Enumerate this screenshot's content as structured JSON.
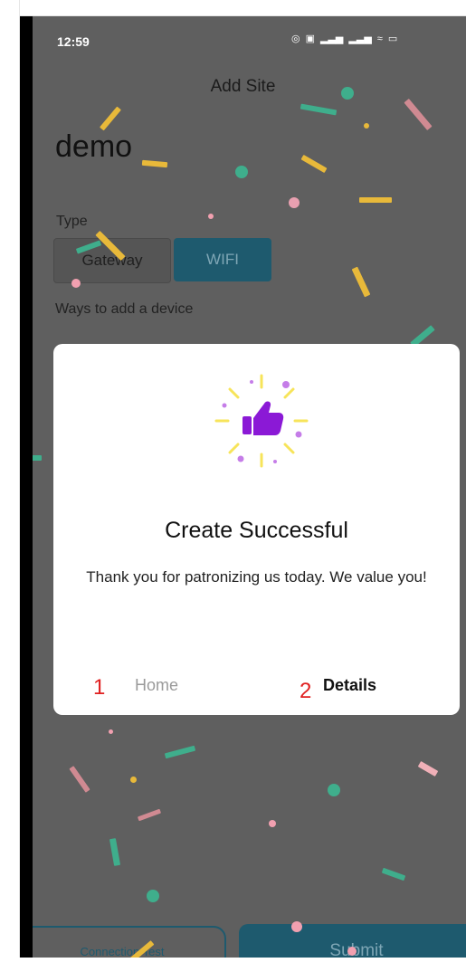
{
  "status_bar": {
    "time": "12:59"
  },
  "header": {
    "title": "Add Site"
  },
  "site": {
    "name": "demo"
  },
  "type_section": {
    "label": "Type",
    "options": [
      "Gateway",
      "WIFI"
    ],
    "selected": "WIFI"
  },
  "ways_label": "Ways to add a device",
  "dialog": {
    "title": "Create Successful",
    "message": "Thank you for patronizing us today. We value you!",
    "annotation_1": "1",
    "home_label": "Home",
    "annotation_2": "2",
    "details_label": "Details"
  },
  "footer": {
    "connection_test": "Connection Test",
    "submit": "Submit"
  },
  "colors": {
    "overlay": "#5f5f5f",
    "accent": "#1e5a6e",
    "annotation": "#e02020",
    "thumb": "#8b19d6"
  }
}
